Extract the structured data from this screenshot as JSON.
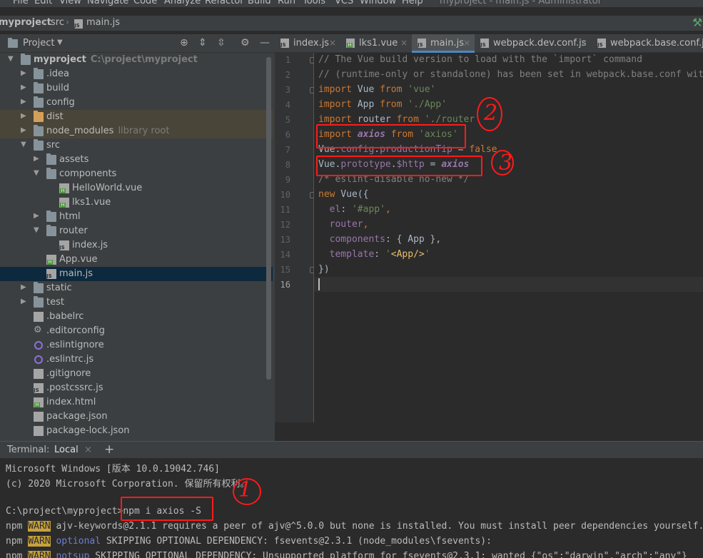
{
  "menu": [
    "File",
    "Edit",
    "View",
    "Navigate",
    "Code",
    "Analyze",
    "Refactor",
    "Build",
    "Run",
    "Tools",
    "VCS",
    "Window",
    "Help"
  ],
  "window_title": "myproject - main.js - Administrator",
  "breadcrumb": {
    "project": "myproject",
    "folder": "src",
    "file": "main.js"
  },
  "project_panel": {
    "title": "Project"
  },
  "tree": [
    {
      "label": "myproject",
      "hint": "C:\\project\\myproject"
    },
    {
      "label": ".idea"
    },
    {
      "label": "build"
    },
    {
      "label": "config"
    },
    {
      "label": "dist"
    },
    {
      "label": "node_modules",
      "hint": "library root"
    },
    {
      "label": "src"
    },
    {
      "label": "assets"
    },
    {
      "label": "components"
    },
    {
      "label": "HelloWorld.vue"
    },
    {
      "label": "lks1.vue"
    },
    {
      "label": "html"
    },
    {
      "label": "router"
    },
    {
      "label": "index.js"
    },
    {
      "label": "App.vue"
    },
    {
      "label": "main.js"
    },
    {
      "label": "static"
    },
    {
      "label": "test"
    },
    {
      "label": ".babelrc"
    },
    {
      "label": ".editorconfig"
    },
    {
      "label": ".eslintignore"
    },
    {
      "label": ".eslintrc.js"
    },
    {
      "label": ".gitignore"
    },
    {
      "label": ".postcssrc.js"
    },
    {
      "label": "index.html"
    },
    {
      "label": "package.json"
    },
    {
      "label": "package-lock.json"
    }
  ],
  "tabs": [
    "index.js",
    "lks1.vue",
    "main.js",
    "webpack.dev.conf.js",
    "webpack.base.conf.js"
  ],
  "line_numbers": [
    "1",
    "2",
    "3",
    "4",
    "5",
    "6",
    "7",
    "8",
    "9",
    "10",
    "11",
    "12",
    "13",
    "14",
    "15",
    "16"
  ],
  "code": {
    "l1": "// The Vue build version to load with the `import` command",
    "l2": "// (runtime-only or standalone) has been set in webpack.base.conf with an alias.",
    "l3_kw": "import",
    "l3_id": " Vue ",
    "l3_from": "from",
    "l3_str": "'vue'",
    "l4_kw": "import",
    "l4_id": " App ",
    "l4_from": "from",
    "l4_str": "'./App'",
    "l5_kw": "import",
    "l5_id": " router ",
    "l5_from": "from",
    "l5_str": "'./router'",
    "l6_kw": "import",
    "l6_id": "axios",
    "l6_from": "from",
    "l6_str": "'axios'",
    "l7_a": "Vue.",
    "l7_b": "config",
    "l7_c": ".",
    "l7_d": "productionTip",
    "l7_e": " = ",
    "l7_f": "false",
    "l8_a": "Vue.",
    "l8_b": "prototype",
    "l8_c": ".",
    "l8_d": "$http",
    "l8_e": " = ",
    "l8_f": "axios",
    "l9": "/* eslint-disable no-new */",
    "l10_kw": "new",
    "l10_rest": " Vue({",
    "l11_prop": "el",
    "l11_colon": ": ",
    "l11_str": "'#app'",
    "l11_end": ",",
    "l12_prop": "router",
    "l12_end": ",",
    "l13_prop": "components",
    "l13_rest": ": { App },",
    "l14_prop": "template",
    "l14_colon": ": ",
    "l14_q1": "'",
    "l14_tag": "<App/>",
    "l14_q2": "'",
    "l15": "})"
  },
  "terminal": {
    "label": "Terminal:",
    "tab": "Local",
    "lines": [
      "Microsoft Windows [版本 10.0.19042.746]",
      "(c) 2020 Microsoft Corporation. 保留所有权利。",
      "",
      "C:\\project\\myproject>npm i axios -S"
    ],
    "w1_pre": "npm ",
    "w1_tag": "WARN",
    "w1_msg": " ajv-keywords@2.1.1 requires a peer of ajv@^5.0.0 but none is installed. You must install peer dependencies yourself.",
    "w2_pre": "npm ",
    "w2_tag": "WARN",
    "w2_opt": " optional",
    "w2_msg": " SKIPPING OPTIONAL DEPENDENCY: fsevents@2.3.1 (node_modules\\fsevents):",
    "w3_pre": "npm ",
    "w3_tag": "WARN",
    "w3_opt": " notsup",
    "w3_msg": " SKIPPING OPTIONAL DEPENDENCY: Unsupported platform for fsevents@2.3.1: wanted {\"os\":\"darwin\",\"arch\":\"any\"}"
  },
  "annotations": {
    "one": "1",
    "two": "2",
    "three": "3"
  },
  "colors": {
    "accent": "#4a88c7",
    "annotation": "#ff1a1a",
    "keyword": "#cc7832",
    "string": "#6a8759"
  }
}
